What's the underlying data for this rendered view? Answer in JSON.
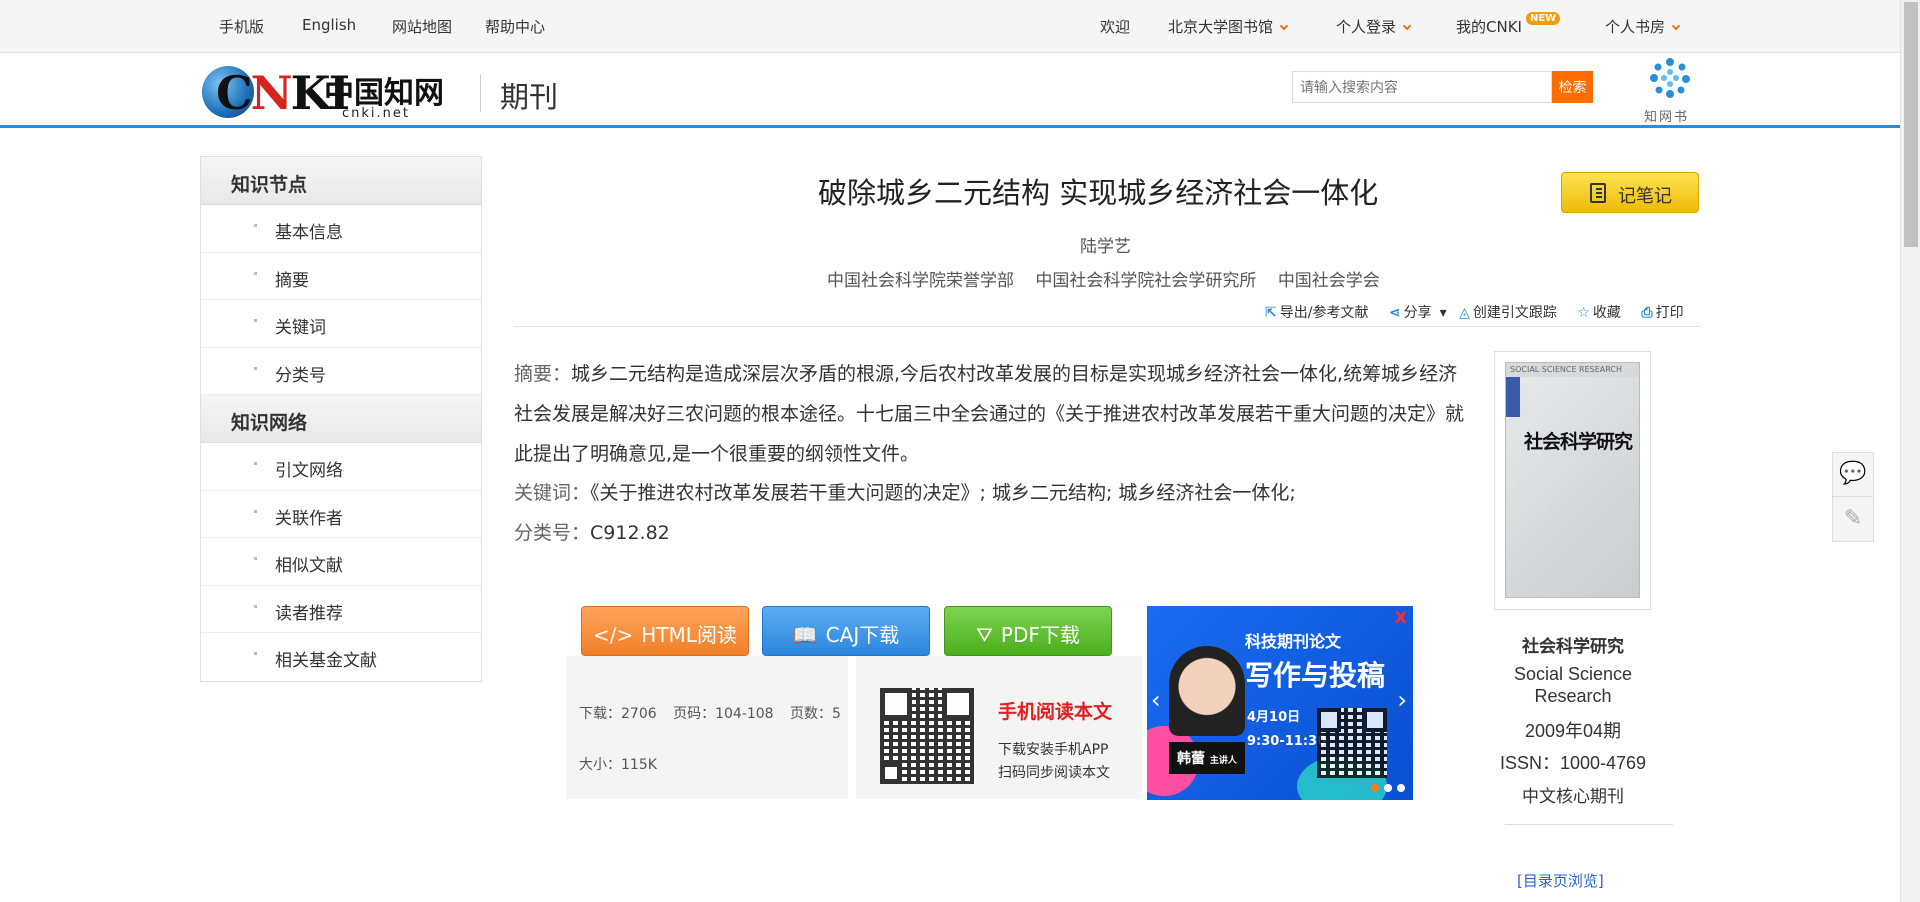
{
  "topbar": {
    "mobile": "手机版",
    "english": "English",
    "sitemap": "网站地图",
    "help": "帮助中心",
    "welcome": "欢迎",
    "library": "北京大学图书馆",
    "login": "个人登录",
    "mycnki": "我的CNKI",
    "new_badge": "NEW",
    "bookroom": "个人书房"
  },
  "header": {
    "logo_cn": "中国知网",
    "logo_url": "cnki.net",
    "section_title": "期刊",
    "search_placeholder": "请输入搜索内容",
    "search_button": "检索",
    "zwb_label": "知网书"
  },
  "sidebar": {
    "sections": [
      {
        "title": "知识节点",
        "items": [
          "基本信息",
          "摘要",
          "关键词",
          "分类号"
        ]
      },
      {
        "title": "知识网络",
        "items": [
          "引文网络",
          "关联作者",
          "相似文献",
          "读者推荐",
          "相关基金文献"
        ]
      }
    ]
  },
  "article": {
    "title": "破除城乡二元结构 实现城乡经济社会一体化",
    "author": "陆学艺",
    "orgs": [
      "中国社会科学院荣誉学部",
      "中国社会科学院社会学研究所",
      "中国社会学会"
    ],
    "note_button": "记笔记",
    "tools": [
      "导出/参考文献",
      "分享",
      "创建引文跟踪",
      "收藏",
      "打印"
    ],
    "abstract_label": "摘要：",
    "abstract": "城乡二元结构是造成深层次矛盾的根源,今后农村改革发展的目标是实现城乡经济社会一体化,统筹城乡经济社会发展是解决好三农问题的根本途径。十七届三中全会通过的《关于推进农村改革发展若干重大问题的决定》就此提出了明确意见,是一个很重要的纲领性文件。",
    "keywords_label": "关键词：",
    "keywords": "《关于推进农村改革发展若干重大问题的决定》; 城乡二元结构; 城乡经济社会一体化;",
    "class_label": "分类号：",
    "class": "C912.82"
  },
  "downloads": {
    "html": "HTML阅读",
    "caj": "CAJ下载",
    "pdf": "PDF下载"
  },
  "stats": {
    "downloads": "下载：2706",
    "pages": "页码：104-108",
    "page_count": "页数：5",
    "size": "大小：115K"
  },
  "mobile": {
    "title": "手机阅读本文",
    "line1": "下载安装手机APP",
    "line2": "扫码同步阅读本文"
  },
  "ad": {
    "close": "X",
    "heading1": "科技期刊论文",
    "heading2": "写作与投稿",
    "date": "4月10日",
    "time": "9:30-11:30",
    "speaker": "韩蕾",
    "speaker_role": "主讲人"
  },
  "journal": {
    "cover_top": "SOCIAL SCIENCE RESEARCH",
    "cover_title": "社会科学研究",
    "name_cn": "社会科学研究",
    "name_en": "Social Science Research",
    "issue": "2009年04期",
    "issn": "ISSN：1000-4769",
    "core": "中文核心期刊",
    "toc_link": "[目录页浏览]"
  },
  "colors": {
    "accent_blue": "#2d8ad6",
    "library_orange": "#e8740f",
    "search_orange": "#ff6d00",
    "note_yellow": "#f5cc1a"
  }
}
